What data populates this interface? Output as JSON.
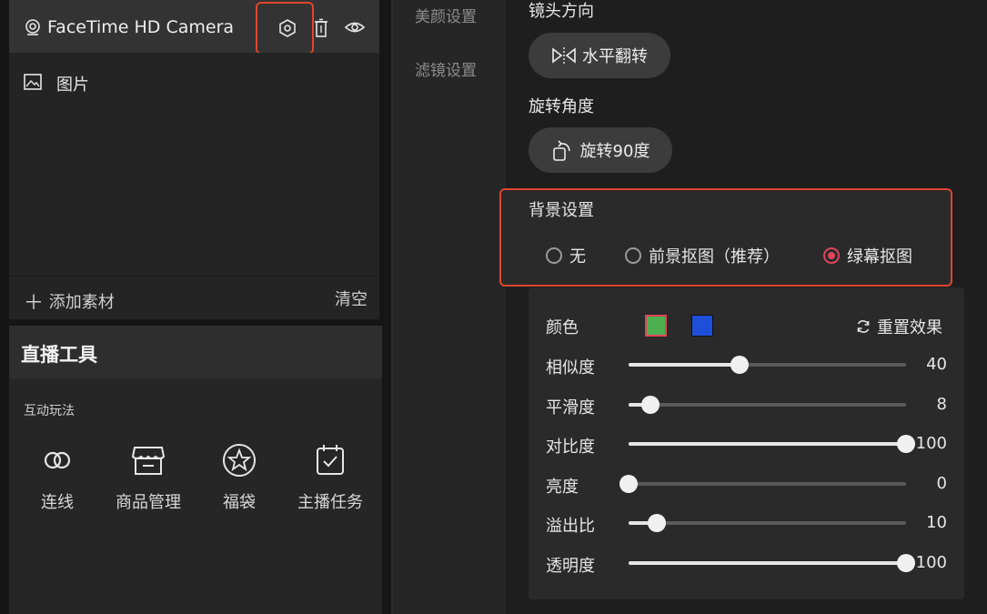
{
  "left": {
    "source_title": "FaceTime HD Camera",
    "image_label": "图片",
    "add_material_label": "添加素材",
    "clear_label": "清空",
    "live_tools_title": "直播工具",
    "interaction_label": "互动玩法",
    "tools": [
      {
        "label": "连线",
        "icon": "link-icon"
      },
      {
        "label": "商品管理",
        "icon": "store-icon"
      },
      {
        "label": "福袋",
        "icon": "star-badge-icon"
      },
      {
        "label": "主播任务",
        "icon": "task-calendar-icon"
      }
    ]
  },
  "nav": {
    "items": [
      "美颜设置",
      "滤镜设置"
    ]
  },
  "settings": {
    "lens_direction_label": "镜头方向",
    "flip_button_label": "水平翻转",
    "rotation_label": "旋转角度",
    "rotate_button_label": "旋转90度",
    "background_label": "背景设置",
    "background_options": [
      {
        "label": "无",
        "selected": false
      },
      {
        "label": "前景抠图（推荐）",
        "selected": false
      },
      {
        "label": "绿幕抠图",
        "selected": true
      }
    ],
    "green_screen": {
      "color_label": "颜色",
      "swatches": [
        {
          "name": "green",
          "color": "#4caf50",
          "selected": true
        },
        {
          "name": "blue",
          "color": "#1e4fd8",
          "selected": false
        }
      ],
      "reset_label": "重置效果",
      "sliders": [
        {
          "label": "相似度",
          "value": "40",
          "max": 100
        },
        {
          "label": "平滑度",
          "value": "8",
          "max": 100
        },
        {
          "label": "对比度",
          "value": "100",
          "max": 100
        },
        {
          "label": "亮度",
          "value": "0",
          "max": 100
        },
        {
          "label": "溢出比",
          "value": "10",
          "max": 100
        },
        {
          "label": "透明度",
          "value": "100",
          "max": 100
        }
      ]
    }
  },
  "colors": {
    "highlight_red": "#e0452f",
    "radio_selected": "#e0455a"
  }
}
